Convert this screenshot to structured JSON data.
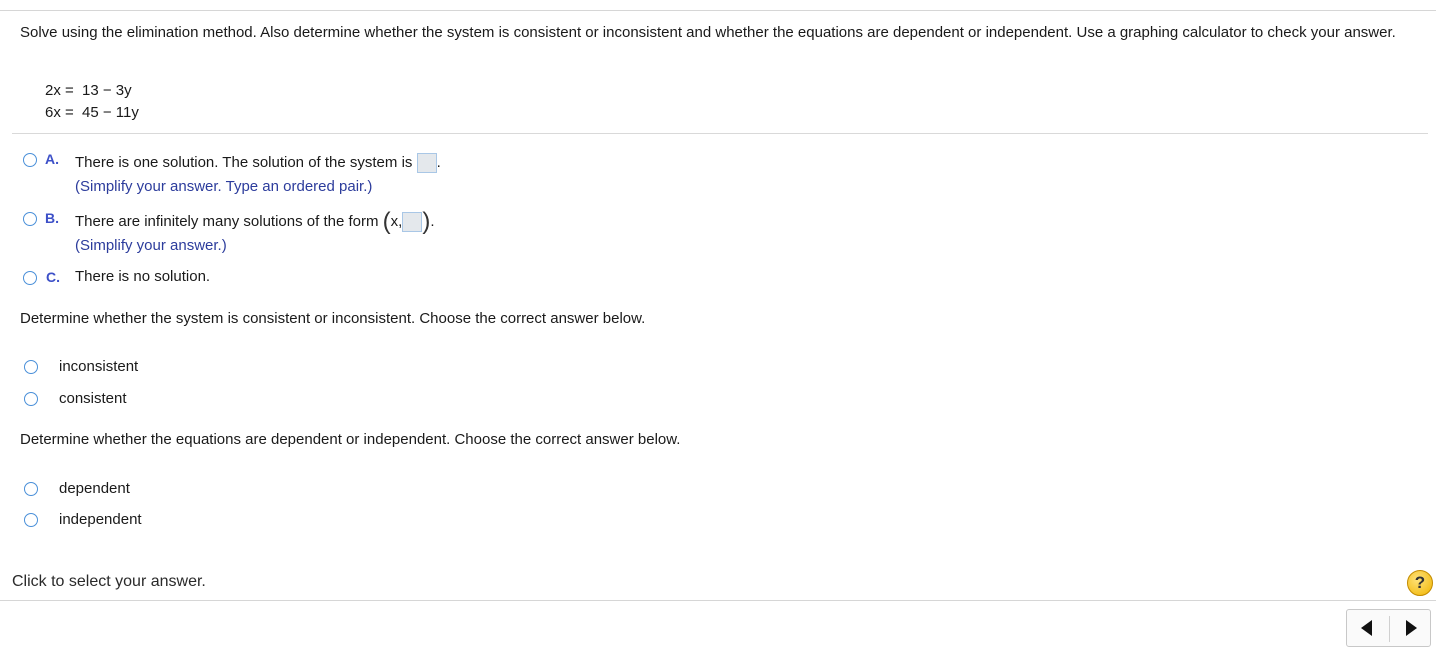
{
  "question": {
    "prompt": "Solve using the elimination method. Also determine whether the system is consistent or inconsistent and whether the equations are dependent or independent. Use a graphing calculator to check your answer.",
    "equations": [
      {
        "lhs": "2x =",
        "rhs": "13 − 3y"
      },
      {
        "lhs": "6x =",
        "rhs": "45 − 11y"
      }
    ]
  },
  "options": [
    {
      "letter": "A.",
      "text": "There is one solution. The solution of the system is",
      "after_box": ".",
      "hint": "(Simplify your answer. Type an ordered pair.)"
    },
    {
      "letter": "B.",
      "text": "There are infinitely many solutions of the form",
      "open_paren": "(",
      "prefix": "x,",
      "close_paren": ")",
      "after_box": ".",
      "hint": "(Simplify your answer.)"
    },
    {
      "letter": "C.",
      "text": "There is no solution."
    }
  ],
  "consistency": {
    "question": "Determine whether the system is consistent or inconsistent. Choose the correct answer below.",
    "choices": [
      "inconsistent",
      "consistent"
    ]
  },
  "dependency": {
    "question": "Determine whether the equations are dependent or independent. Choose the correct answer below.",
    "choices": [
      "dependent",
      "independent"
    ]
  },
  "footer": {
    "status": "Click to select your answer.",
    "help_symbol": "?"
  },
  "colors": {
    "option_letter": "#3d50c8",
    "hint_text": "#2c3c9c",
    "radio_border": "#4a90d9",
    "help_button": "#f0b400"
  },
  "icons": {
    "prev": "triangle-left",
    "next": "triangle-right",
    "help": "question-circle"
  }
}
